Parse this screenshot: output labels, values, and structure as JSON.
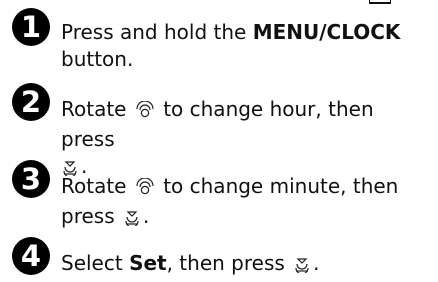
{
  "steps": [
    {
      "number": "1",
      "parts": {
        "a": "Press and hold the ",
        "b": "MENU/CLOCK",
        "c": " button."
      }
    },
    {
      "number": "2",
      "parts": {
        "a": "Rotate ",
        "b": " to change hour, then press ",
        "c": "."
      },
      "icons": [
        "dial-icon",
        "enter-button-icon"
      ]
    },
    {
      "number": "3",
      "parts": {
        "a": "Rotate ",
        "b": " to change minute, then press ",
        "c": "."
      },
      "icons": [
        "dial-icon",
        "enter-button-icon"
      ]
    },
    {
      "number": "4",
      "parts": {
        "a": "Select ",
        "b": "Set",
        "c": ", then press ",
        "d": "."
      },
      "icons": [
        "enter-button-icon"
      ]
    }
  ]
}
